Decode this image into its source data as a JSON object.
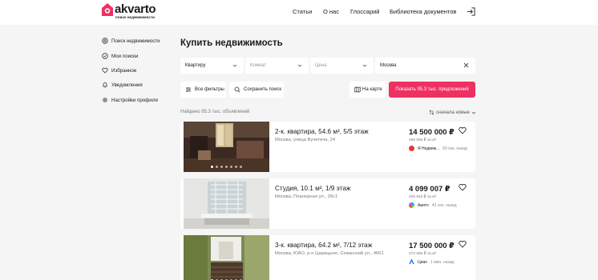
{
  "header": {
    "logo_text": "akvarto",
    "logo_sub": "поиск недвижимости",
    "nav": [
      "Статьи",
      "О нас",
      "Глоссарий",
      "Библиотека документов"
    ]
  },
  "sidebar": {
    "items": [
      {
        "label": "Поиск недвижимости",
        "icon": "search-icon"
      },
      {
        "label": "Мои поиски",
        "icon": "saved-search-icon"
      },
      {
        "label": "Избранное",
        "icon": "heart-icon"
      },
      {
        "label": "Уведомления",
        "icon": "bell-icon"
      },
      {
        "label": "Настройки профиля",
        "icon": "gear-icon"
      }
    ]
  },
  "main": {
    "title": "Купить недвижимость",
    "filters": {
      "type": "Квартиру",
      "rooms_placeholder": "Комнат",
      "price_placeholder": "Цена",
      "location": "Москва"
    },
    "buttons": {
      "all_filters": "Все фильтры",
      "save_search": "Сохранить поиск",
      "map": "На карте",
      "show": "Показать 95.3 тыс. предложений"
    },
    "found": "Найдено 95.3 тыс. объявлений",
    "sort": "сначала новые",
    "listings": [
      {
        "title": "2-к. квартира, 54.6 м², 5/5 этаж",
        "address": "Москва, улица Вучетича, 24",
        "price": "14 500 000 ₽",
        "per_m2": "265 568 ₽ за м²",
        "source": "Я Недвиж...",
        "time": "50 сек. назад",
        "source_color": "#e53935"
      },
      {
        "title": "Студия, 10.1 м², 1/9 этаж",
        "address": "Москва, Планерная ул., 26с1",
        "price": "4 099 007 ₽",
        "per_m2": "405 843 ₽ за м²",
        "source": "Авито",
        "time": "43 сек. назад",
        "source_color": "#00aaff"
      },
      {
        "title": "3-к. квартира, 64.2 м², 7/12 этаж",
        "address": "Москва, ЮАО, р-н Царицыно, Севанский ул., 46К1",
        "price": "17 500 000 ₽",
        "per_m2": "272 586 ₽ за м²",
        "source": "Циан",
        "time": "1 мин. назад",
        "source_color": "#0468ff"
      }
    ]
  },
  "colors": {
    "accent": "#ef3062",
    "background": "#f5f5f5"
  }
}
